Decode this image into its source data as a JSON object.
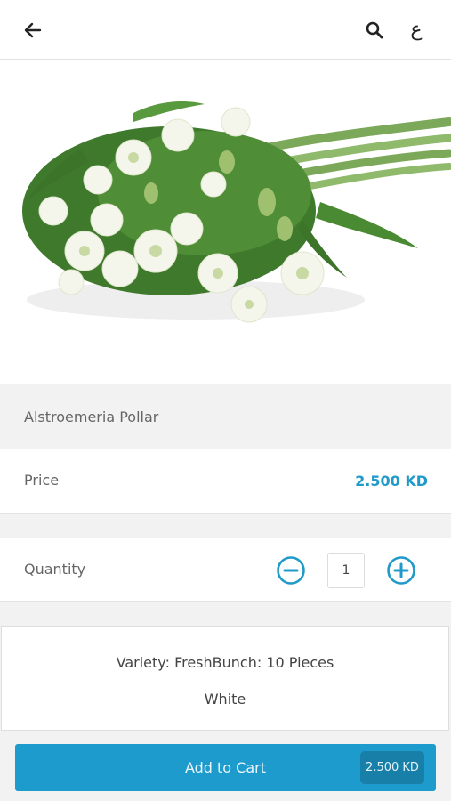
{
  "header": {
    "back_icon": "arrow-left-icon",
    "search_icon": "search-icon",
    "language_toggle": "ع"
  },
  "product": {
    "name": "Alstroemeria Pollar",
    "image": "white-alstroemeria-bouquet"
  },
  "price": {
    "label": "Price",
    "value": "2.500 KD"
  },
  "quantity": {
    "label": "Quantity",
    "value": "1"
  },
  "variety": {
    "line1": "Variety: FreshBunch: 10 Pieces",
    "line2": "White"
  },
  "cart": {
    "label": "Add to Cart",
    "price": "2.500 KD"
  },
  "colors": {
    "accent": "#1f9ac9",
    "button": "#1e9bcd",
    "button_badge": "#187fa8"
  }
}
